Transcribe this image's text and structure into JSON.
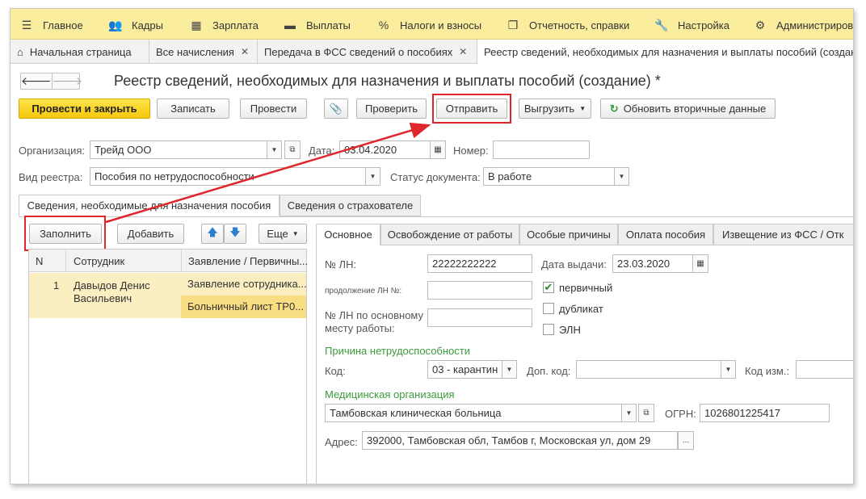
{
  "menu": {
    "items": [
      {
        "label": "Главное",
        "icon": "list-icon"
      },
      {
        "label": "Кадры",
        "icon": "users-icon"
      },
      {
        "label": "Зарплата",
        "icon": "calculator-icon"
      },
      {
        "label": "Выплаты",
        "icon": "wallet-icon"
      },
      {
        "label": "Налоги и взносы",
        "icon": "percent-icon"
      },
      {
        "label": "Отчетность, справки",
        "icon": "reports-icon"
      },
      {
        "label": "Настройка",
        "icon": "wrench-icon"
      },
      {
        "label": "Администриров",
        "icon": "gear-icon"
      }
    ]
  },
  "tabs": [
    {
      "label": "Начальная страница"
    },
    {
      "label": "Все начисления"
    },
    {
      "label": "Передача в ФСС сведений о пособиях"
    },
    {
      "label": "Реестр сведений, необходимых для назначения и выплаты пособий (создание) *"
    }
  ],
  "doc": {
    "title": "Реестр сведений, необходимых для назначения и выплаты пособий (создание) *"
  },
  "toolbar": {
    "post_close": "Провести и закрыть",
    "save": "Записать",
    "post": "Провести",
    "check": "Проверить",
    "send": "Отправить",
    "export": "Выгрузить",
    "refresh": "Обновить вторичные данные"
  },
  "header": {
    "org_label": "Организация:",
    "org_value": "Трейд ООО",
    "date_label": "Дата:",
    "date_value": "03.04.2020",
    "number_label": "Номер:",
    "number_value": "",
    "registry_type_label": "Вид реестра:",
    "registry_type_value": "Пособия по нетрудоспособности",
    "status_label": "Статус документа:",
    "status_value": "В работе"
  },
  "section_tabs": [
    {
      "label": "Сведения, необходимые для назначения пособия"
    },
    {
      "label": "Сведения о страхователе"
    }
  ],
  "left_panel": {
    "fill_button": "Заполнить",
    "add_button": "Добавить",
    "more_button": "Еще",
    "columns": [
      "N",
      "Сотрудник",
      "Заявление / Первичны..."
    ],
    "rows": [
      {
        "n": "1",
        "employee": "Давыдов Денис Васильевич",
        "docs": [
          "Заявление сотрудника...",
          "Больничный лист ТР0..."
        ]
      }
    ]
  },
  "detail_tabs": [
    {
      "label": "Основное"
    },
    {
      "label": "Освобождение от работы"
    },
    {
      "label": "Особые причины"
    },
    {
      "label": "Оплата пособия"
    },
    {
      "label": "Извещение из ФСС / Отк"
    }
  ],
  "detail": {
    "ln_label": "№ ЛН:",
    "ln_value": "22222222222",
    "issue_date_label": "Дата выдачи:",
    "issue_date_value": "23.03.2020",
    "continuation_label": "продолжение ЛН №:",
    "continuation_value": "",
    "main_ln_label_1": "№ ЛН по основному",
    "main_ln_label_2": "месту работы:",
    "main_ln_value": "",
    "primary_label": "первичный",
    "primary_checked": true,
    "duplicate_label": "дубликат",
    "eln_label": "ЭЛН",
    "cause_section": "Причина нетрудоспособности",
    "code_label": "Код:",
    "code_value": "03 - карантин",
    "extra_code_label": "Доп. код:",
    "extra_code_value": "",
    "change_code_label": "Код изм.:",
    "change_code_value": "",
    "med_section": "Медицинская организация",
    "med_org_value": "Тамбовская клиническая больница",
    "ogrn_label": "ОГРН:",
    "ogrn_value": "1026801225417",
    "address_label": "Адрес:",
    "address_value": "392000, Тамбовская обл, Тамбов г, Московская ул, дом 29"
  },
  "colors": {
    "menu_bg": "#fbed9e",
    "accent_yellow": "#f5c80c",
    "highlight_red": "#e0262b",
    "section_green": "#3c9b3c",
    "selected_row": "#fbeec0"
  }
}
